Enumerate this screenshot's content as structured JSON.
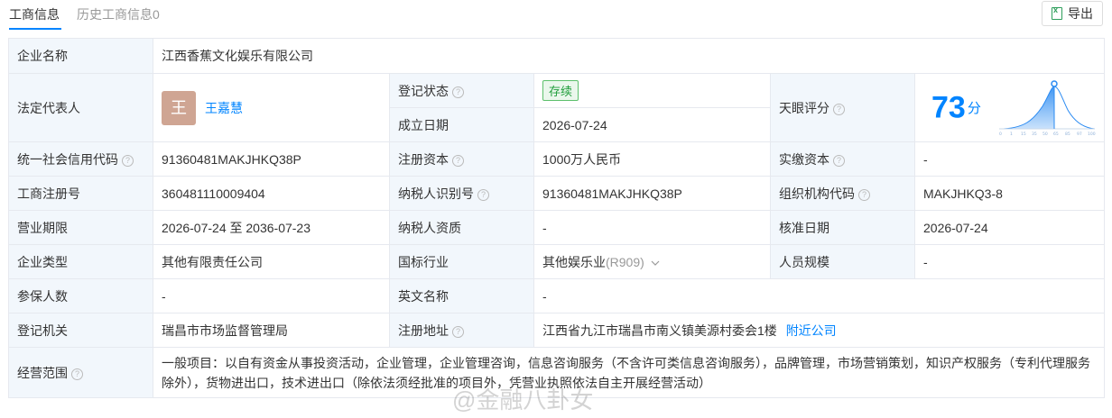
{
  "tabs": {
    "active": "工商信息",
    "history": "历史工商信息0"
  },
  "export_label": "导出",
  "company": {
    "label": "企业名称",
    "value": "江西香蕉文化娱乐有限公司"
  },
  "legal_rep": {
    "label": "法定代表人",
    "avatar": "王",
    "name": "王嘉慧"
  },
  "reg_status": {
    "label": "登记状态",
    "value": "存续"
  },
  "est_date": {
    "label": "成立日期",
    "value": "2026-07-24"
  },
  "tianyan": {
    "label": "天眼评分",
    "score": "73",
    "unit": "分",
    "axis": [
      "0",
      "1",
      "15",
      "35",
      "50",
      "65",
      "85",
      "97",
      "100"
    ]
  },
  "credit_code": {
    "label": "统一社会信用代码",
    "value": "91360481MAKJHKQ38P"
  },
  "reg_capital": {
    "label": "注册资本",
    "value": "1000万人民币"
  },
  "paid_capital": {
    "label": "实缴资本",
    "value": "-"
  },
  "reg_no": {
    "label": "工商注册号",
    "value": "360481110009404"
  },
  "taxpayer_id": {
    "label": "纳税人识别号",
    "value": "91360481MAKJHKQ38P"
  },
  "org_code": {
    "label": "组织机构代码",
    "value": "MAKJHKQ3-8"
  },
  "term": {
    "label": "营业期限",
    "value": "2026-07-24 至 2036-07-23"
  },
  "taxpayer_qual": {
    "label": "纳税人资质",
    "value": "-"
  },
  "approve_date": {
    "label": "核准日期",
    "value": "2026-07-24"
  },
  "ent_type": {
    "label": "企业类型",
    "value": "其他有限责任公司"
  },
  "industry": {
    "label": "国标行业",
    "value": "其他娱乐业",
    "code": "(R909)"
  },
  "staff_size": {
    "label": "人员规模",
    "value": "-"
  },
  "insured": {
    "label": "参保人数",
    "value": "-"
  },
  "english_name": {
    "label": "英文名称",
    "value": "-"
  },
  "authority": {
    "label": "登记机关",
    "value": "瑞昌市市场监督管理局"
  },
  "address": {
    "label": "注册地址",
    "value": "江西省九江市瑞昌市南义镇美源村委会1楼",
    "link": "附近公司"
  },
  "scope": {
    "label": "经营范围",
    "value": "一般项目：以自有资金从事投资活动，企业管理，企业管理咨询，信息咨询服务（不含许可类信息咨询服务），品牌管理，市场营销策划，知识产权服务（专利代理服务除外），货物进出口，技术进出口（除依法须经批准的项目外，凭营业执照依法自主开展经营活动）"
  },
  "watermark": "@金融八卦女",
  "colors": {
    "accent": "#0084ff",
    "label_bg": "#f2f7fc",
    "border": "#e6e9ef",
    "status_green": "#1f9d3a",
    "avatar_bg": "#cfa593"
  }
}
